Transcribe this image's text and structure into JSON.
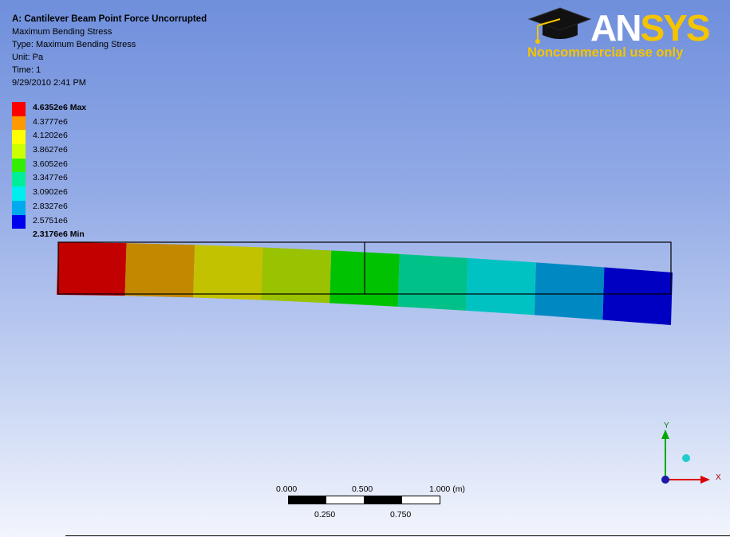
{
  "info": {
    "title": "A: Cantilever Beam Point Force Uncorrupted",
    "lines": [
      "Maximum Bending Stress",
      "Type: Maximum Bending Stress",
      "Unit: Pa",
      "Time: 1",
      "9/29/2010 2:41 PM"
    ]
  },
  "legend": {
    "max_label": "4.6352e6 Max",
    "min_label": "2.3176e6 Min",
    "levels": [
      "4.3777e6",
      "4.1202e6",
      "3.8627e6",
      "3.6052e6",
      "3.3477e6",
      "3.0902e6",
      "2.8327e6",
      "2.5751e6"
    ],
    "colors": [
      "#ff0000",
      "#ff9900",
      "#ffff00",
      "#ccff00",
      "#33ee00",
      "#00ee99",
      "#00eeee",
      "#00aaee",
      "#0000ee"
    ]
  },
  "logo": {
    "brand_prefix": "AN",
    "brand_suffix": "SYS",
    "subtitle": "Noncommercial use only"
  },
  "scale_bar": {
    "top_labels": [
      "0.000",
      "0.500",
      "1.000 (m)"
    ],
    "bottom_labels": [
      "0.250",
      "0.750"
    ]
  },
  "triad": {
    "x_label": "X",
    "y_label": "Y"
  },
  "beam": {
    "segment_colors": [
      "#c20000",
      "#c28800",
      "#c2c200",
      "#99c200",
      "#00c200",
      "#00c288",
      "#00c2c2",
      "#0088c2",
      "#0000c2"
    ]
  }
}
